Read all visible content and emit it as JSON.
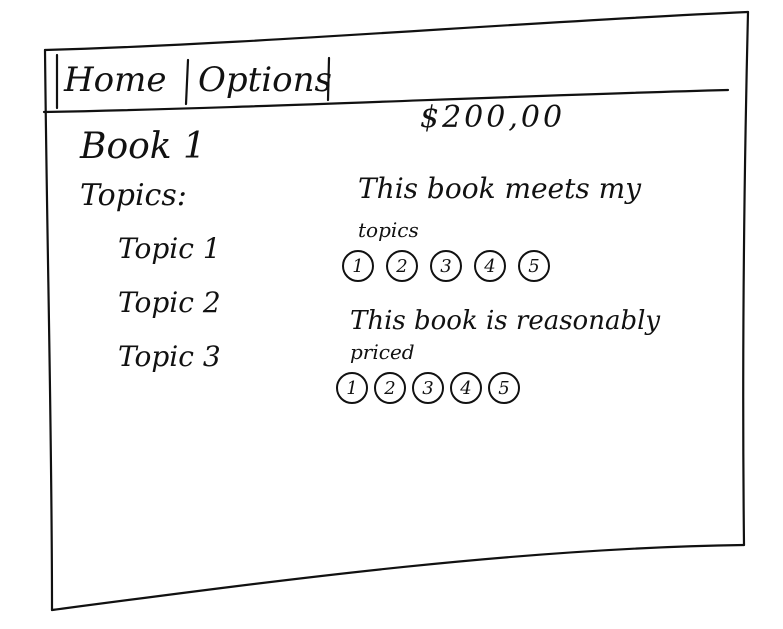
{
  "nav": {
    "home_label": "Home",
    "options_label": "Options"
  },
  "book": {
    "title": "Book 1",
    "price": "$200,00",
    "topics_label": "Topics:",
    "topics": [
      "Topic 1",
      "Topic 2",
      "Topic 3"
    ]
  },
  "questions": [
    {
      "line1": "This book meets my",
      "line2": "topics",
      "options": [
        "1",
        "2",
        "3",
        "4",
        "5"
      ]
    },
    {
      "line1": "This book is reasonably",
      "line2": "priced",
      "options": [
        "1",
        "2",
        "3",
        "4",
        "5"
      ]
    }
  ]
}
